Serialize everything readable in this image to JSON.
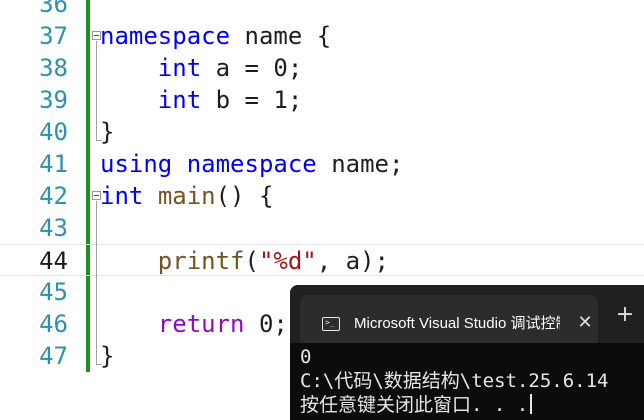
{
  "editor": {
    "lines": [
      {
        "num": "36",
        "tokens": []
      },
      {
        "num": "37",
        "tokens": [
          {
            "t": "namespace",
            "c": "kw"
          },
          {
            "t": " name {",
            "c": "plain"
          }
        ]
      },
      {
        "num": "38",
        "tokens": [
          {
            "t": "    ",
            "c": "plain"
          },
          {
            "t": "int",
            "c": "kw"
          },
          {
            "t": " a = 0;",
            "c": "plain"
          }
        ]
      },
      {
        "num": "39",
        "tokens": [
          {
            "t": "    ",
            "c": "plain"
          },
          {
            "t": "int",
            "c": "kw"
          },
          {
            "t": " b = 1;",
            "c": "plain"
          }
        ]
      },
      {
        "num": "40",
        "tokens": [
          {
            "t": "}",
            "c": "plain"
          }
        ]
      },
      {
        "num": "41",
        "tokens": [
          {
            "t": "using",
            "c": "kw"
          },
          {
            "t": " ",
            "c": "plain"
          },
          {
            "t": "namespace",
            "c": "kw"
          },
          {
            "t": " name;",
            "c": "plain"
          }
        ]
      },
      {
        "num": "42",
        "tokens": [
          {
            "t": "int",
            "c": "kw"
          },
          {
            "t": " ",
            "c": "plain"
          },
          {
            "t": "main",
            "c": "fn"
          },
          {
            "t": "() {",
            "c": "plain"
          }
        ]
      },
      {
        "num": "43",
        "tokens": []
      },
      {
        "num": "44",
        "tokens": [
          {
            "t": "    ",
            "c": "plain"
          },
          {
            "t": "printf",
            "c": "fn"
          },
          {
            "t": "(",
            "c": "plain"
          },
          {
            "t": "\"%d\"",
            "c": "str"
          },
          {
            "t": ", a);",
            "c": "plain"
          }
        ]
      },
      {
        "num": "45",
        "tokens": []
      },
      {
        "num": "46",
        "tokens": [
          {
            "t": "    ",
            "c": "plain"
          },
          {
            "t": "return",
            "c": "kw2"
          },
          {
            "t": " 0;",
            "c": "plain"
          }
        ]
      },
      {
        "num": "47",
        "tokens": [
          {
            "t": "}",
            "c": "plain"
          }
        ]
      }
    ],
    "current_line": "44"
  },
  "terminal": {
    "icon": "terminal-icon",
    "tab_title": "Microsoft Visual Studio 调试控制台",
    "close_glyph": "✕",
    "new_tab_glyph": "+",
    "output": [
      "0",
      "C:\\代码\\数据结构\\test.25.6.14",
      "按任意键关闭此窗口. . ."
    ]
  }
}
